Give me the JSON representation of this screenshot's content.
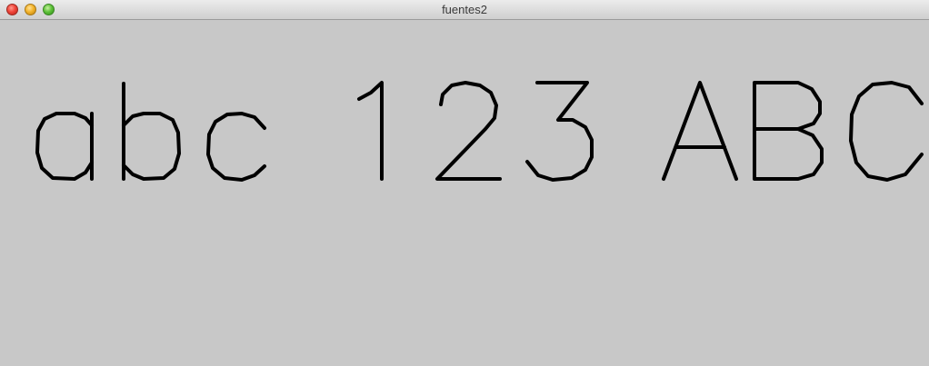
{
  "window": {
    "title": "fuentes2"
  },
  "canvas": {
    "words": [
      "abc",
      "123",
      "ABC"
    ],
    "stroke_color": "#000000",
    "background_color": "#c8c8c8"
  },
  "icons": {
    "close": "close-button-icon",
    "minimize": "minimize-button-icon",
    "zoom": "zoom-button-icon"
  }
}
